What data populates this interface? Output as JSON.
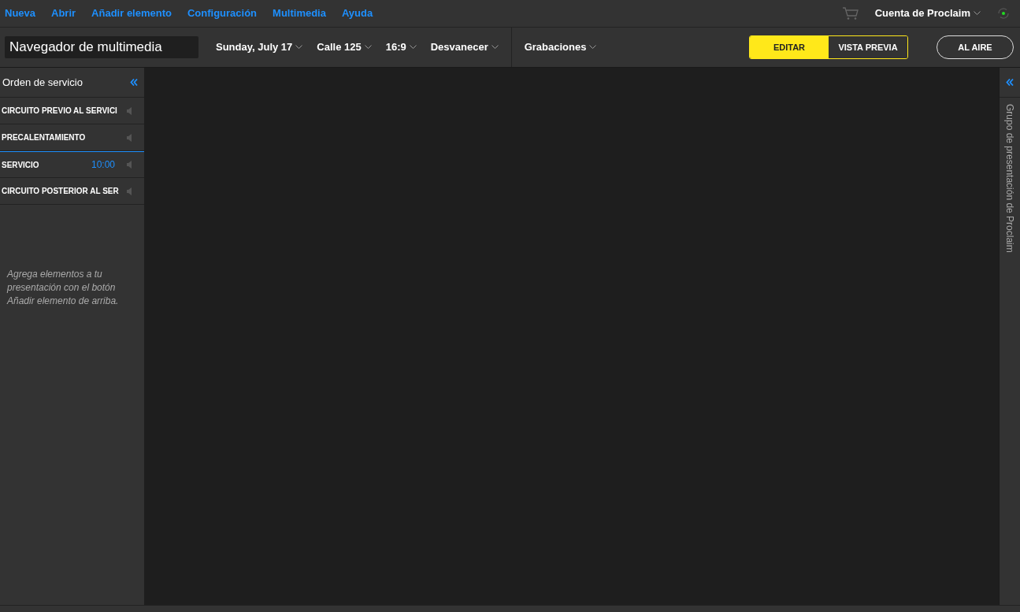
{
  "menu": [
    "Nueva",
    "Abrir",
    "Añadir elemento",
    "Configuración",
    "Multimedia",
    "Ayuda"
  ],
  "account": {
    "label": "Cuenta de Proclaim"
  },
  "toolbar": {
    "title": "Navegador de multimedia",
    "dropdowns": [
      "Sunday, July 17",
      "Calle 125",
      "16:9",
      "Desvanecer"
    ],
    "recordings": "Grabaciones",
    "modes": [
      {
        "label": "EDITAR",
        "selected": true
      },
      {
        "label": "VISTA PREVIA",
        "selected": false
      }
    ],
    "on_air": "AL AIRE"
  },
  "sidebar": {
    "title": "Orden de servicio",
    "items": [
      {
        "label": "CIRCUITO PREVIO AL SERVICI",
        "selected": false
      },
      {
        "label": "PRECALENTAMIENTO",
        "selected": false
      },
      {
        "label": "SERVICIO",
        "time": "10:00",
        "selected": true
      },
      {
        "label": "CIRCUITO POSTERIOR AL SER",
        "selected": false
      }
    ],
    "hint": "Agrega elementos a tu presentación con el botón Añadir elemento de arriba."
  },
  "right_panel": {
    "title": "Grupo de presentación de Proclaim"
  }
}
